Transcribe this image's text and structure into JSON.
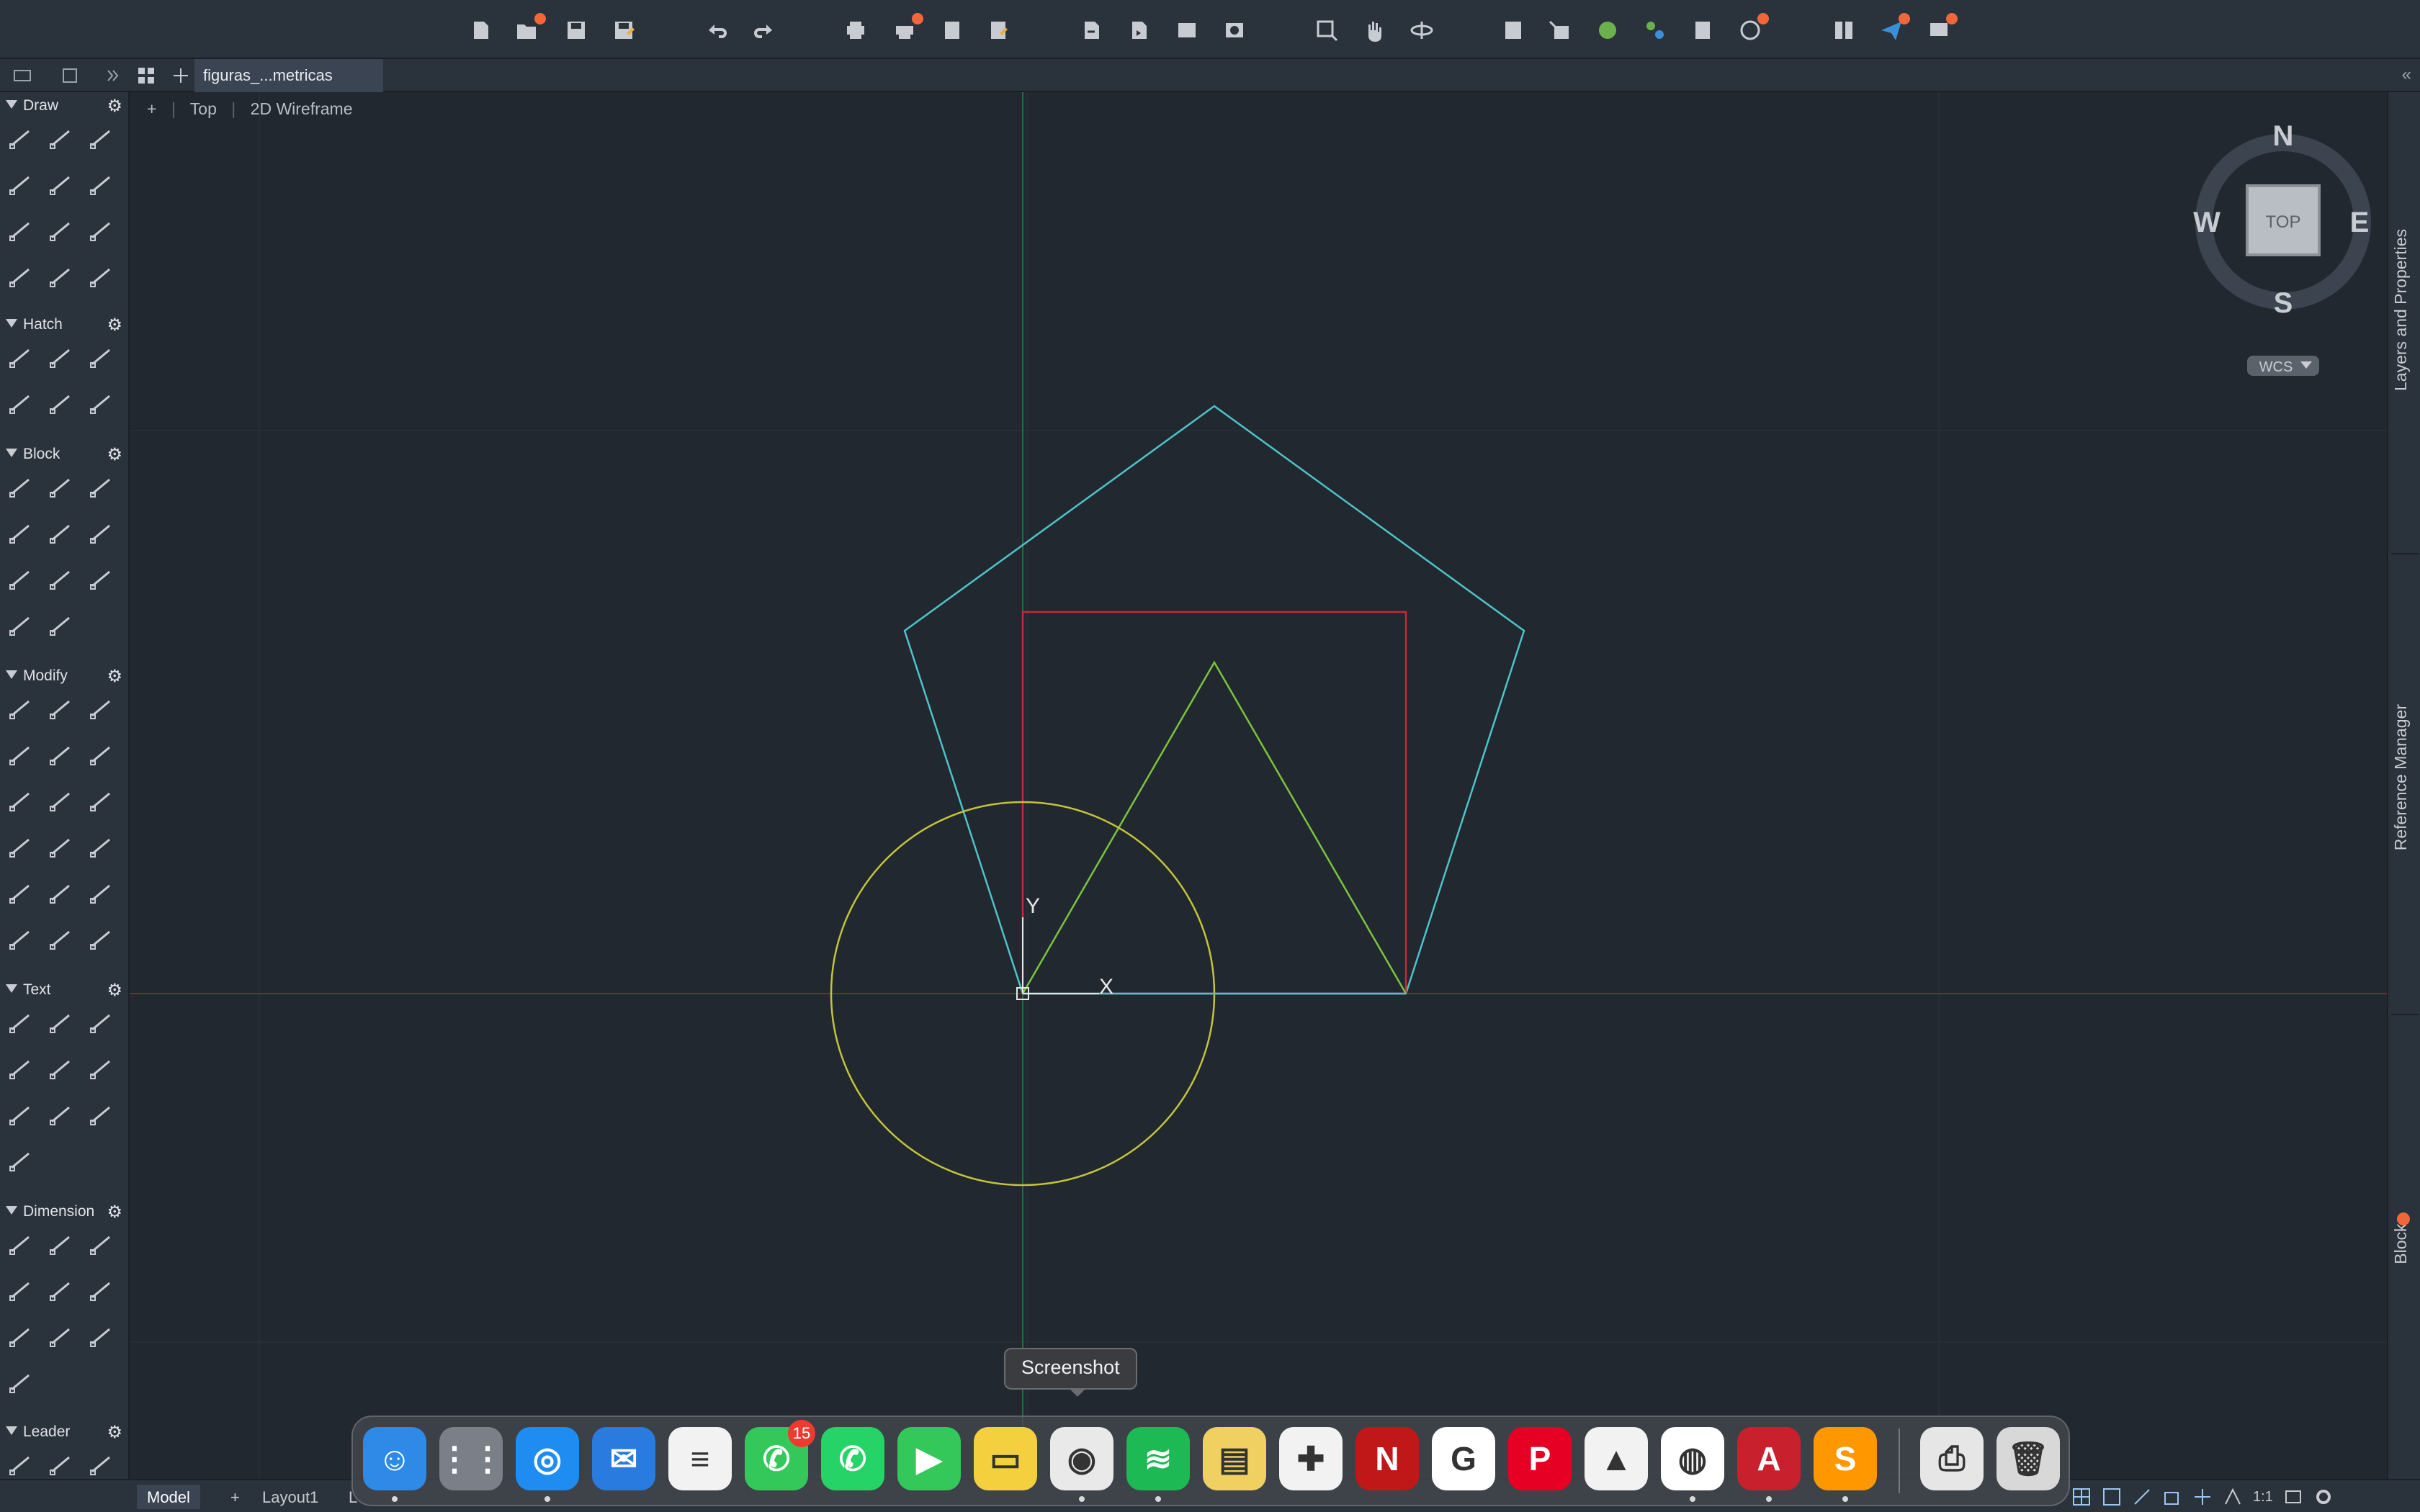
{
  "document": {
    "tab_title": "figuras_...metricas"
  },
  "viewport": {
    "view_minus": "+",
    "view_name": "Top",
    "visual_style": "2D Wireframe"
  },
  "viewcube": {
    "north": "N",
    "south": "S",
    "east": "E",
    "west": "W",
    "face": "TOP",
    "ucs": "WCS"
  },
  "ucs_icon": {
    "x_label": "X",
    "y_label": "Y"
  },
  "palette": {
    "sections": [
      {
        "id": "draw",
        "label": "Draw"
      },
      {
        "id": "hatch",
        "label": "Hatch"
      },
      {
        "id": "block",
        "label": "Block"
      },
      {
        "id": "modify",
        "label": "Modify"
      },
      {
        "id": "text",
        "label": "Text"
      },
      {
        "id": "dimension",
        "label": "Dimension"
      },
      {
        "id": "leader",
        "label": "Leader"
      }
    ]
  },
  "right_palettes": {
    "layers": "Layers and Properties",
    "reference": "Reference Manager",
    "blocks": "Blocks"
  },
  "layout_tabs": {
    "model": "Model",
    "add": "+",
    "layout1": "Layout1",
    "more": "L"
  },
  "status": {
    "scale": "1:1"
  },
  "dock": {
    "tooltip": "Screenshot",
    "messages_badge": "15",
    "apps": [
      "Finder",
      "Launchpad",
      "Safari",
      "Mail",
      "Reminders",
      "Messages",
      "WhatsApp",
      "FaceTime",
      "Notes",
      "Screenshot",
      "Spotify",
      "Stickies",
      "Capcut",
      "Netflix",
      "Google",
      "Pinterest",
      "Moodle",
      "Chrome",
      "AutoCAD",
      "Sublime Text",
      "Printer",
      "Trash"
    ]
  },
  "colors": {
    "background": "#212830",
    "pentagon": "#4fc3c9",
    "square": "#c8283a",
    "triangle": "#7cc43c",
    "circle": "#c4c43a",
    "x_axis": "#7a2a30",
    "y_axis": "#2f6a3c"
  }
}
